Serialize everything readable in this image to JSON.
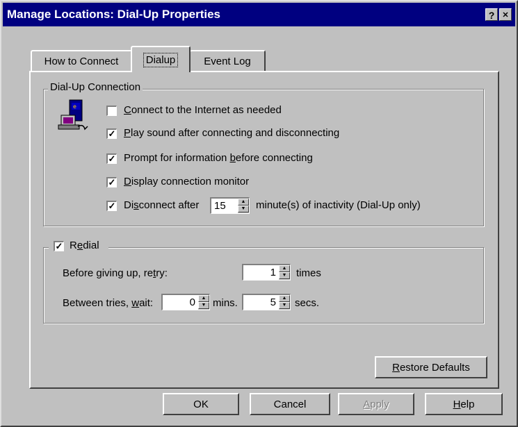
{
  "window": {
    "title": "Manage Locations:  Dial-Up Properties",
    "help_button": "?",
    "close_button": "✕"
  },
  "tabs": [
    {
      "label": "How to Connect"
    },
    {
      "label": "Dialup",
      "active": true
    },
    {
      "label": "Event Log"
    }
  ],
  "dialup_group": {
    "legend": "Dial-Up Connection",
    "icon": "dialup-computer-icon",
    "options": [
      {
        "pre": "",
        "key": "C",
        "post": "onnect to the Internet as needed",
        "checked": false,
        "mark": ""
      },
      {
        "pre": "",
        "key": "P",
        "post": "lay sound after connecting and disconnecting",
        "checked": true,
        "mark": "✓"
      },
      {
        "pre": "Prompt for information ",
        "key": "b",
        "post": "efore connecting",
        "checked": true,
        "mark": "✓"
      },
      {
        "pre": "",
        "key": "D",
        "post": "isplay connection monitor",
        "checked": true,
        "mark": "✓"
      }
    ],
    "disconnect": {
      "pre": "Di",
      "key": "s",
      "post": "connect after",
      "checked": true,
      "mark": "✓",
      "value": "15",
      "suffix": "minute(s) of inactivity (Dial-Up only)"
    }
  },
  "redial_group": {
    "checked": true,
    "mark": "✓",
    "label_pre": "R",
    "label_key": "e",
    "label_post": "dial",
    "retry_pre": "Before giving up, re",
    "retry_key": "t",
    "retry_post": "ry:",
    "retry_value": "1",
    "retry_unit": "times",
    "wait_pre": "Between tries, ",
    "wait_key": "w",
    "wait_post": "ait:",
    "wait_mins_value": "0",
    "mins_unit": "mins.",
    "wait_secs_value": "5",
    "secs_unit": "secs."
  },
  "restore": {
    "key": "R",
    "post": "estore Defaults"
  },
  "buttons": {
    "ok": "OK",
    "cancel": "Cancel",
    "apply_key": "A",
    "apply_post": "pply",
    "help_key": "H",
    "help_post": "elp"
  },
  "colors": {
    "titlebar": "#000080",
    "face": "#c0c0c0"
  }
}
